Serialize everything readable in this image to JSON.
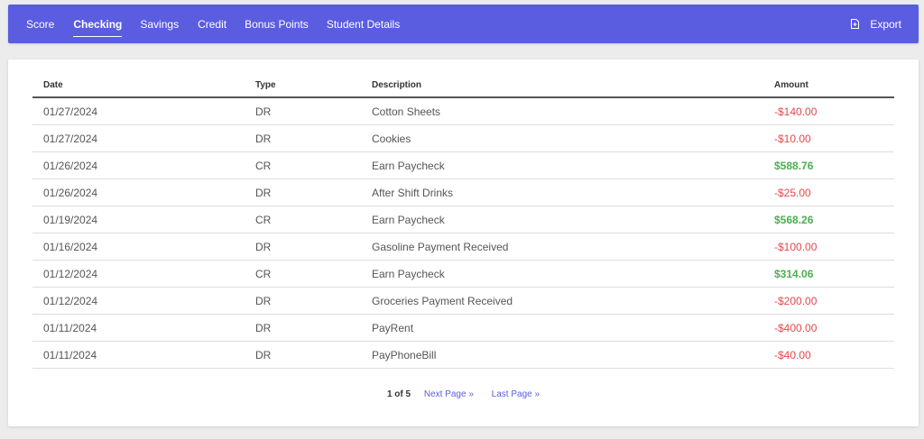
{
  "nav": {
    "tabs": [
      {
        "label": "Score"
      },
      {
        "label": "Checking"
      },
      {
        "label": "Savings"
      },
      {
        "label": "Credit"
      },
      {
        "label": "Bonus Points"
      },
      {
        "label": "Student Details"
      }
    ],
    "active_tab": "Checking",
    "export_label": "Export",
    "export_icon": "file-export-icon"
  },
  "colors": {
    "nav_bg": "#5b5de0",
    "negative": "#e5484d",
    "positive": "#4caf50",
    "link": "#5b5de0"
  },
  "table": {
    "headers": {
      "date": "Date",
      "type": "Type",
      "description": "Description",
      "amount": "Amount"
    },
    "rows": [
      {
        "date": "01/27/2024",
        "type": "DR",
        "description": "Cotton Sheets",
        "amount": "-$140.00"
      },
      {
        "date": "01/27/2024",
        "type": "DR",
        "description": "Cookies",
        "amount": "-$10.00"
      },
      {
        "date": "01/26/2024",
        "type": "CR",
        "description": "Earn Paycheck",
        "amount": "$588.76"
      },
      {
        "date": "01/26/2024",
        "type": "DR",
        "description": "After Shift Drinks",
        "amount": "-$25.00"
      },
      {
        "date": "01/19/2024",
        "type": "CR",
        "description": "Earn Paycheck",
        "amount": "$568.26"
      },
      {
        "date": "01/16/2024",
        "type": "DR",
        "description": "Gasoline Payment Received",
        "amount": "-$100.00"
      },
      {
        "date": "01/12/2024",
        "type": "CR",
        "description": "Earn Paycheck",
        "amount": "$314.06"
      },
      {
        "date": "01/12/2024",
        "type": "DR",
        "description": "Groceries Payment Received",
        "amount": "-$200.00"
      },
      {
        "date": "01/11/2024",
        "type": "DR",
        "description": "PayRent",
        "amount": "-$400.00"
      },
      {
        "date": "01/11/2024",
        "type": "DR",
        "description": "PayPhoneBill",
        "amount": "-$40.00"
      }
    ]
  },
  "pagination": {
    "page_count": "1 of 5",
    "next_label": "Next Page »",
    "last_label": "Last Page »"
  }
}
